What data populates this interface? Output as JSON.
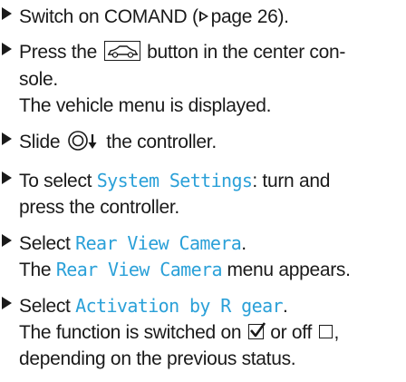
{
  "steps": [
    {
      "a": "Switch on COMAND (",
      "ref": "page 26",
      "b": ")."
    },
    {
      "a": "Press the",
      "b": "button in the center con-",
      "c": "sole.",
      "result": "The vehicle menu is displayed."
    },
    {
      "a": "Slide",
      "b": "the controller."
    },
    {
      "a": "To select",
      "menu": "System Settings",
      "b": ": turn and",
      "c": "press the controller."
    },
    {
      "a": "Select",
      "menu": "Rear View Camera",
      "b": ".",
      "result_a": "The",
      "result_menu": "Rear View Camera",
      "result_b": "menu appears."
    },
    {
      "a": "Select",
      "menu": "Activation by R gear",
      "b": ".",
      "result_a": "The function is switched on",
      "result_b": "or off",
      "result_c": ",",
      "result_d": "depending on the previous status."
    }
  ],
  "icons": {
    "bullet": "triangle-bullet-icon",
    "page_ref": "page-reference-triangle-icon",
    "vehicle_button": "car-button-icon",
    "controller_slide": "controller-slide-down-icon",
    "checked": "checked-checkbox-icon",
    "unchecked": "unchecked-checkbox-icon"
  },
  "colors": {
    "menu_text": "#2aa0d8",
    "text": "#1a1a1a"
  }
}
